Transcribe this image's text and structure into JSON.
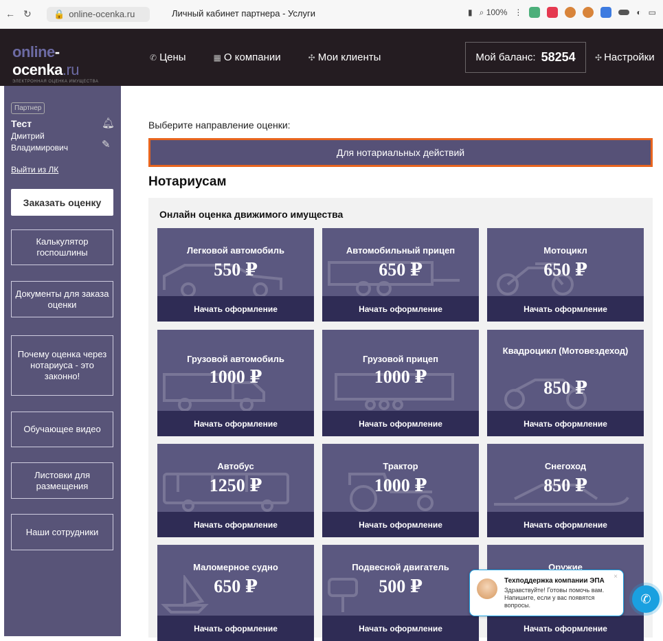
{
  "browser": {
    "url": "online-ocenka.ru",
    "tab_title": "Личный кабинет партнера - Услуги",
    "zoom": "100%"
  },
  "header": {
    "logo_main_a": "online",
    "logo_main_b": "-ocenka",
    "logo_ru": ".ru",
    "logo_tagline": "ЭЛЕКТРОННАЯ ОЦЕНКА ИМУЩЕСТВА",
    "menu": [
      {
        "label": "Цены",
        "icon": "tag-icon"
      },
      {
        "label": "О компании",
        "icon": "building-icon"
      },
      {
        "label": "Мои клиенты",
        "icon": "people-icon"
      }
    ],
    "balance_label": "Мой баланс:",
    "balance_value": "58254",
    "settings_label": "Настройки"
  },
  "sidebar": {
    "badge": "Партнер",
    "user_short": "Тест",
    "user_full": "Дмитрий Владимирович",
    "logout": "Выйти из ЛК",
    "order_button": "Заказать оценку",
    "items": [
      "Калькулятор госпошлины",
      "Документы для заказа оценки",
      "Почему оценка через нотариуса - это законно!",
      "Обучающее видео",
      "Листовки для размещения",
      "Наши сотрудники"
    ]
  },
  "main": {
    "choose_label": "Выберите направление оценки:",
    "direction_button": "Для нотариальных действий",
    "section_title": "Нотариусам",
    "panel_title": "Онлайн оценка движимого имущества",
    "cta_label": "Начать оформление",
    "cards": [
      {
        "name": "Легковой автомобиль",
        "price": "550 ₽"
      },
      {
        "name": "Автомобильный прицеп",
        "price": "650 ₽"
      },
      {
        "name": "Мотоцикл",
        "price": "650 ₽"
      },
      {
        "name": "Грузовой автомобиль",
        "price": "1000 ₽"
      },
      {
        "name": "Грузовой прицеп",
        "price": "1000 ₽"
      },
      {
        "name": "Квадроцикл (Мотовездеход)",
        "price": "850 ₽"
      },
      {
        "name": "Автобус",
        "price": "1250 ₽"
      },
      {
        "name": "Трактор",
        "price": "1000 ₽"
      },
      {
        "name": "Снегоход",
        "price": "850 ₽"
      },
      {
        "name": "Маломерное судно",
        "price": "650 ₽"
      },
      {
        "name": "Подвесной двигатель",
        "price": "500 ₽"
      },
      {
        "name": "Оружие",
        "price": ""
      }
    ]
  },
  "chat": {
    "title": "Техподдержка компании ЭПА",
    "message": "Здравствуйте! Готовы помочь вам. Напишите, если у вас появятся вопросы."
  },
  "colors": {
    "sidebar": "#585478",
    "card": "#5b5880",
    "card_cta": "#2f2c55",
    "accent": "#e8651f",
    "header": "#241c21",
    "chat": "#1aa0e0"
  }
}
